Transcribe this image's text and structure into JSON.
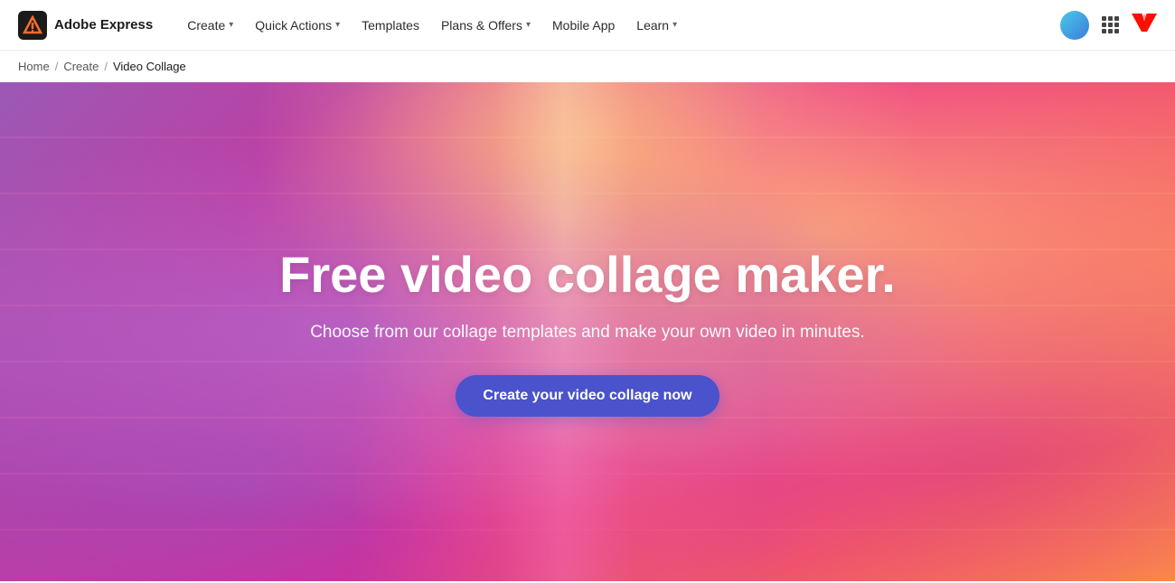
{
  "brand": {
    "logo_text": "Adobe Express",
    "logo_bg": "#1a1a1a"
  },
  "nav": {
    "links": [
      {
        "label": "Create",
        "has_dropdown": true
      },
      {
        "label": "Quick Actions",
        "has_dropdown": true
      },
      {
        "label": "Templates",
        "has_dropdown": false
      },
      {
        "label": "Plans & Offers",
        "has_dropdown": true
      },
      {
        "label": "Mobile App",
        "has_dropdown": false
      },
      {
        "label": "Learn",
        "has_dropdown": true
      }
    ]
  },
  "breadcrumb": {
    "home": "Home",
    "create": "Create",
    "current": "Video Collage"
  },
  "hero": {
    "title": "Free video collage maker.",
    "subtitle": "Choose from our collage templates and make your own video in minutes.",
    "cta_label": "Create your video collage now"
  }
}
